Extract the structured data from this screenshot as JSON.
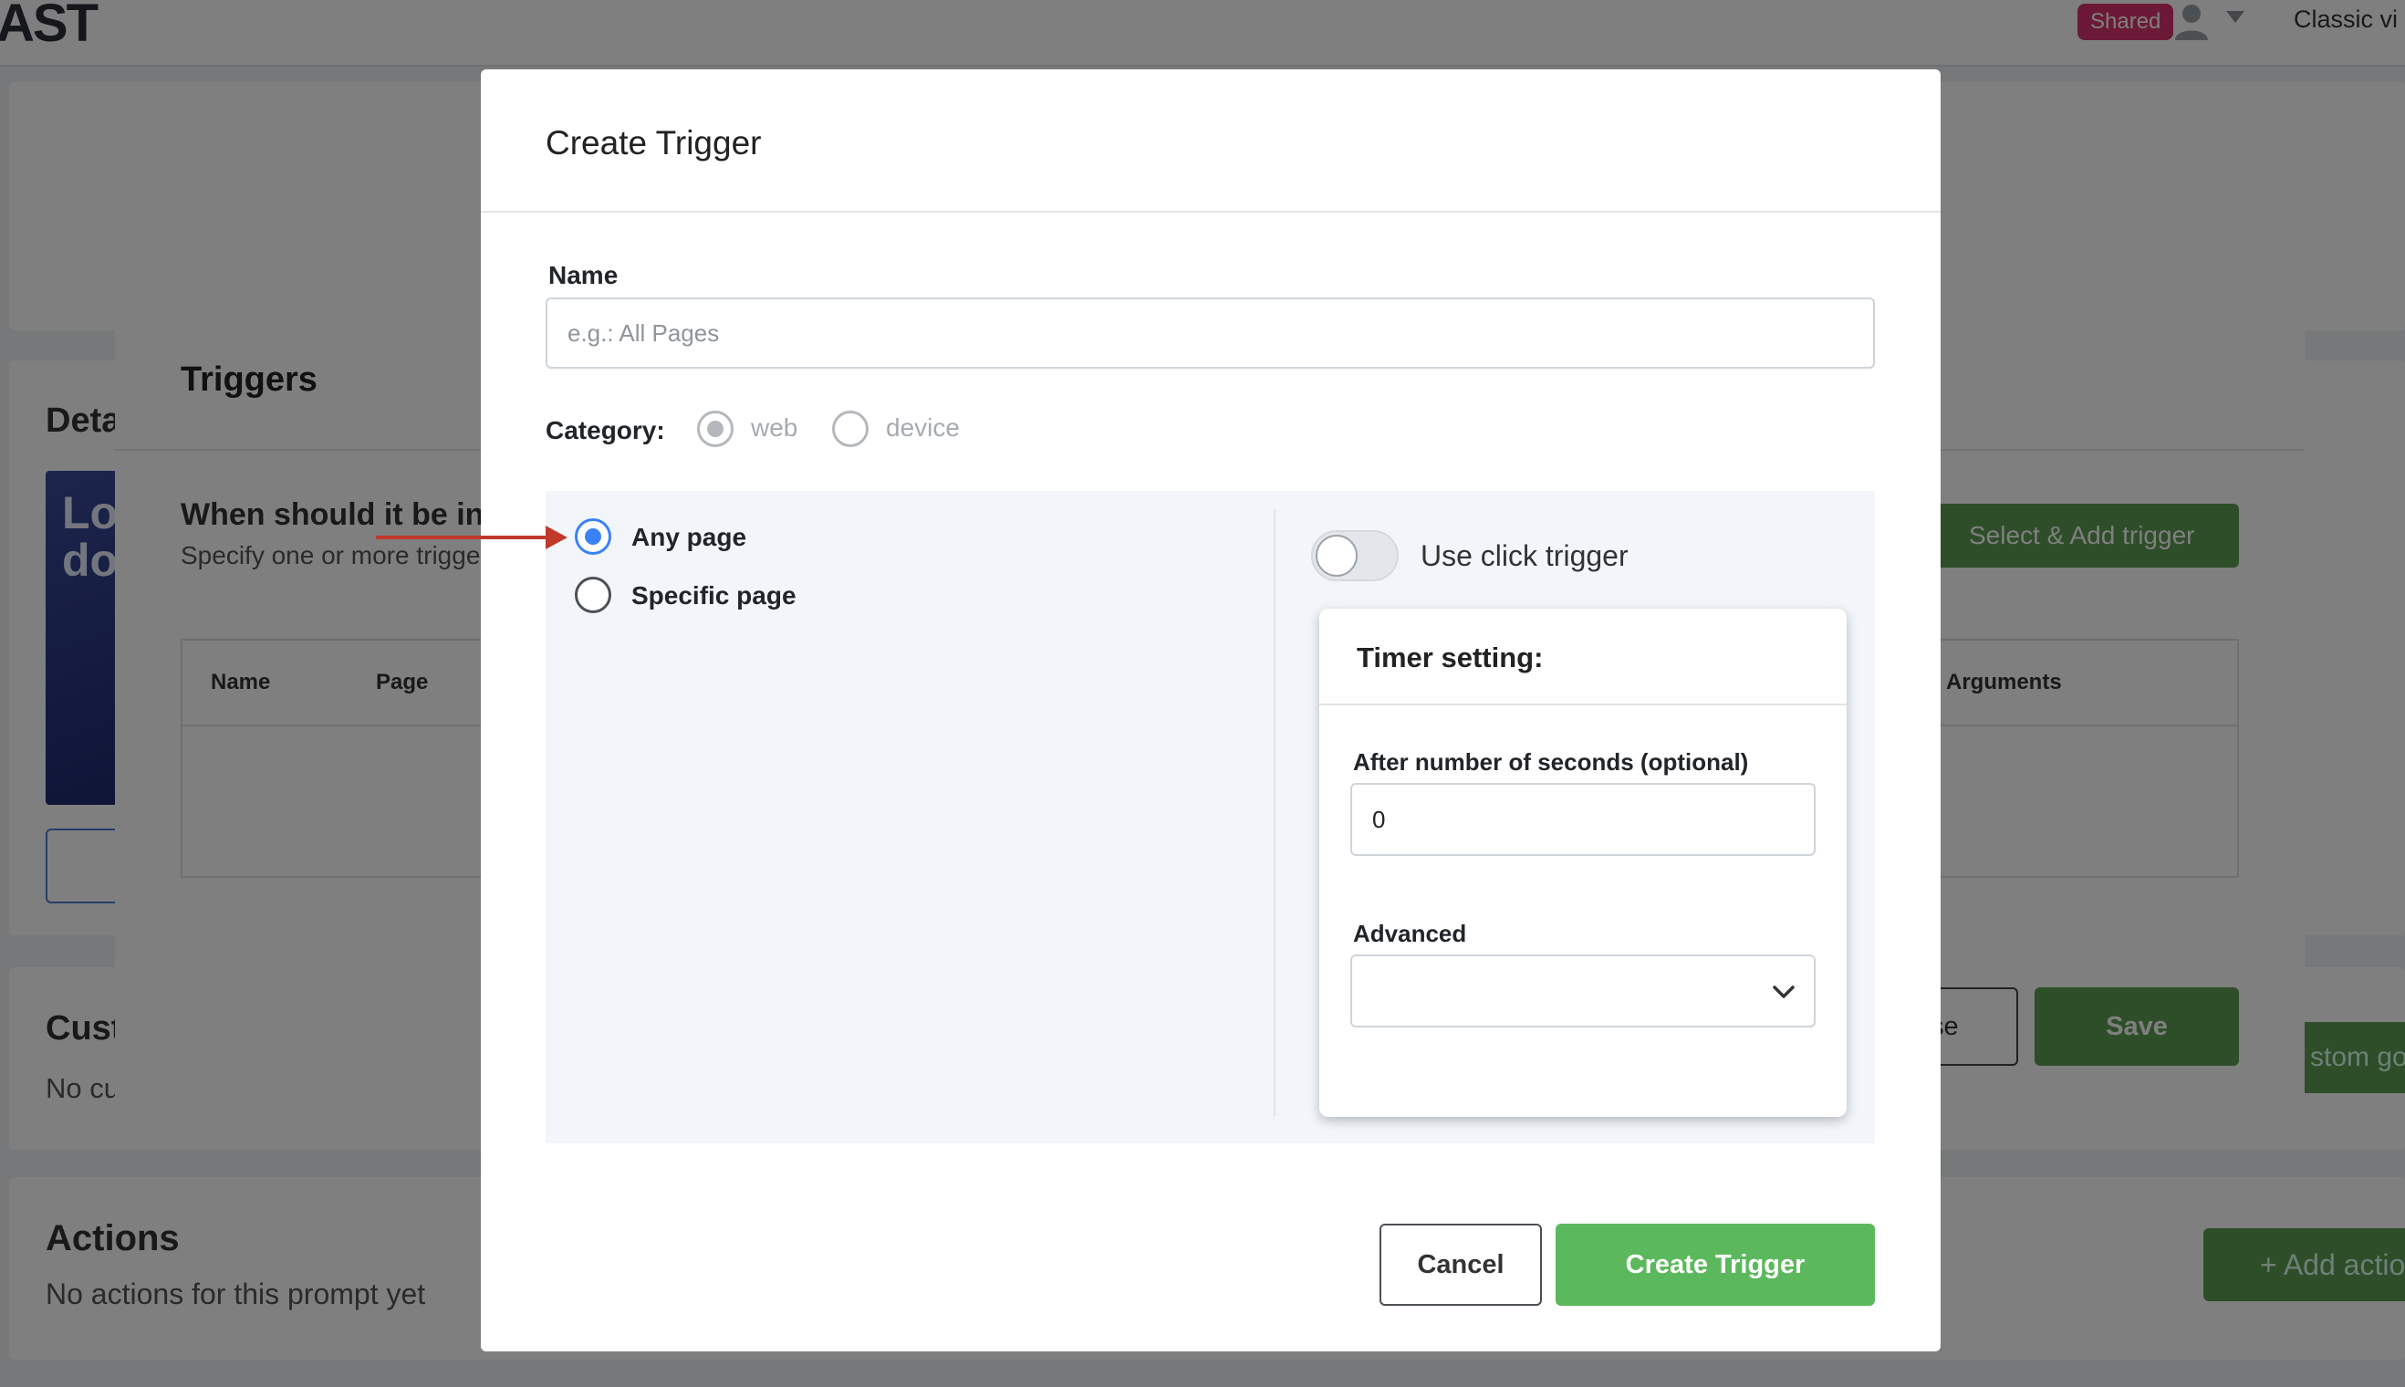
{
  "app": {
    "logo_text": "AST",
    "shared_badge": "Shared",
    "classic_view_label": "Classic vi",
    "details_title": "Deta",
    "thumbnail_text": "Lo do",
    "custom_goals_title": "Cust",
    "custom_goals_empty": "No cu",
    "add_custom_goal_label": "stom go",
    "actions_title": "Actions",
    "actions_empty": "No actions for this prompt yet",
    "add_action_label": "+ Add actio"
  },
  "triggers_modal": {
    "title": "Triggers",
    "question": "When should it be init",
    "help": "Specify one or more trigge",
    "select_add_label": "Select & Add trigger",
    "columns": [
      "Name",
      "Page",
      "Arguments"
    ],
    "close_label": "se",
    "save_label": "Save"
  },
  "create_trigger": {
    "title": "Create Trigger",
    "name_label": "Name",
    "name_placeholder": "e.g.: All Pages",
    "name_value": "",
    "category_label": "Category:",
    "category_options": [
      "web",
      "device"
    ],
    "category_selected": "web",
    "page_options": [
      "Any page",
      "Specific page"
    ],
    "page_selected": "Any page",
    "click_trigger_label": "Use click trigger",
    "click_trigger_enabled": false,
    "timer": {
      "title": "Timer setting:",
      "seconds_label": "After number of seconds (optional)",
      "seconds_value": "0",
      "advanced_label": "Advanced",
      "advanced_value": ""
    },
    "cancel_label": "Cancel",
    "submit_label": "Create Trigger"
  },
  "colors": {
    "accent_blue": "#3b82f6",
    "primary_green": "#5cb85c",
    "annotation_arrow": "#c0392b",
    "badge_pink": "#d6336c"
  }
}
